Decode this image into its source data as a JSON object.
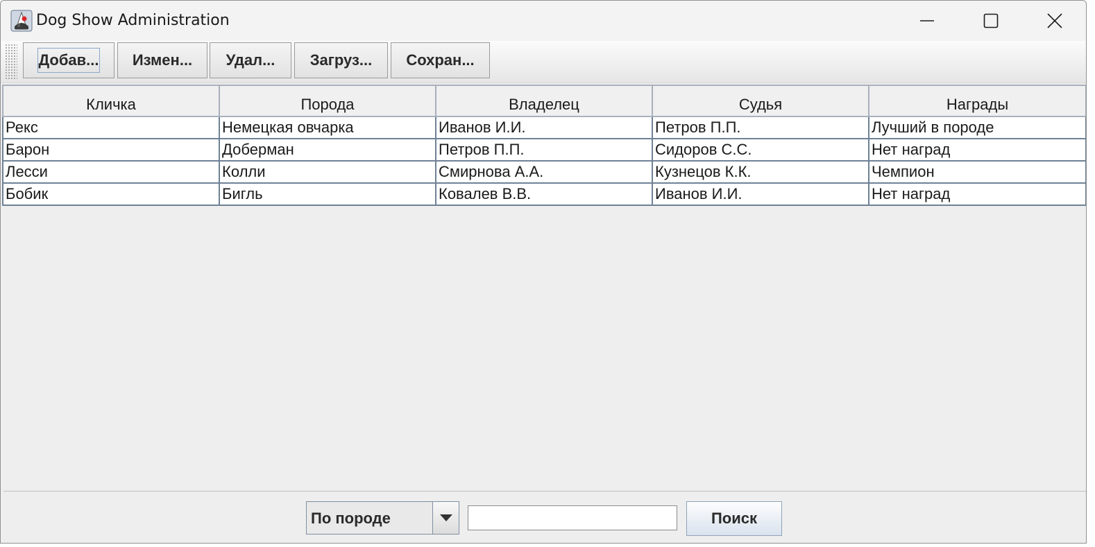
{
  "window": {
    "title": "Dog Show Administration"
  },
  "toolbar": {
    "buttons": [
      {
        "label": "Добав..."
      },
      {
        "label": "Измен..."
      },
      {
        "label": "Удал..."
      },
      {
        "label": "Загруз..."
      },
      {
        "label": "Сохран..."
      }
    ]
  },
  "table": {
    "columns": [
      "Кличка",
      "Порода",
      "Владелец",
      "Судья",
      "Награды"
    ],
    "rows": [
      [
        "Рекс",
        "Немецкая овчарка",
        "Иванов И.И.",
        "Петров П.П.",
        "Лучший в породе"
      ],
      [
        "Барон",
        "Доберман",
        "Петров П.П.",
        "Сидоров С.С.",
        "Нет наград"
      ],
      [
        "Лесси",
        "Колли",
        "Смирнова А.А.",
        "Кузнецов К.К.",
        "Чемпион"
      ],
      [
        "Бобик",
        "Бигль",
        "Ковалев В.В.",
        "Иванов И.И.",
        "Нет наград"
      ]
    ]
  },
  "search": {
    "mode_selected": "По породе",
    "query_value": "",
    "button_label": "Поиск"
  }
}
